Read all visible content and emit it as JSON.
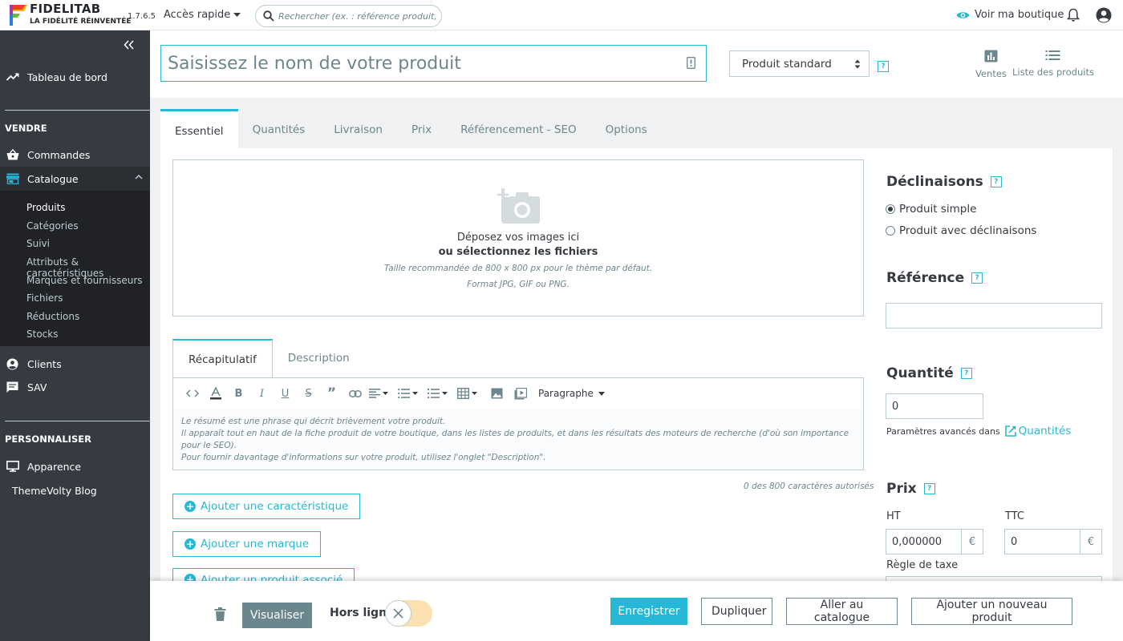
{
  "header": {
    "brand": "FIDELITAB",
    "tagline": "LA FIDÉLITÉ RÉINVENTÉE",
    "version": "1.7.6.5",
    "quick_access": "Accès rapide",
    "search_placeholder": "Rechercher (ex. : référence produit, nom",
    "view_shop": "Voir ma boutique",
    "accent": "#25b9d7"
  },
  "sidebar": {
    "dashboard": "Tableau de bord",
    "section_sell": "VENDRE",
    "orders": "Commandes",
    "catalog": "Catalogue",
    "catalog_sub": [
      "Produits",
      "Catégories",
      "Suivi",
      "Attributs & caractéristiques",
      "Marques et fournisseurs",
      "Fichiers",
      "Réductions",
      "Stocks"
    ],
    "clients": "Clients",
    "sav": "SAV",
    "section_customize": "PERSONNALISER",
    "appearance": "Apparence",
    "blog": "ThemeVolty Blog"
  },
  "product": {
    "name_placeholder": "Saisissez le nom de votre produit",
    "type_value": "Produit standard",
    "sales": "Ventes",
    "product_list": "Liste des produits",
    "help": "?"
  },
  "tabs": [
    "Essentiel",
    "Quantités",
    "Livraison",
    "Prix",
    "Référencement - SEO",
    "Options"
  ],
  "dropzone": {
    "line1": "Déposez vos images ici",
    "line2": "ou sélectionnez les fichiers",
    "line3": "Taille recommandée de 800 x 800 px pour le thème par défaut.",
    "line4": "Format JPG, GIF ou PNG."
  },
  "subtabs": [
    "Récapitulatif",
    "Description"
  ],
  "editor": {
    "paragraph": "Paragraphe",
    "placeholder_lines": [
      "Le résumé est une phrase qui décrit brièvement votre produit.",
      "Il apparaît tout en haut de la fiche produit de votre boutique, dans les listes de produits, et dans les résultats des moteurs de recherche (d'où son importance pour le SEO).",
      "Pour fournir davantage d'informations sur votre produit, utilisez l'onglet \"Description\"."
    ],
    "char_count": "0 des 800 caractères autorisés"
  },
  "actions": {
    "add_feature": "Ajouter une caractéristique",
    "add_brand": "Ajouter une marque",
    "add_related": "Ajouter un produit associé"
  },
  "right": {
    "declinaisons": "Déclinaisons",
    "simple": "Produit simple",
    "with_variants": "Produit avec déclinaisons",
    "reference": "Référence",
    "reference_value": "",
    "quantity": "Quantité",
    "quantity_value": "0",
    "advanced": "Paramètres avancés dans",
    "advanced_link": "Quantités",
    "price": "Prix",
    "ht": "HT",
    "ht_value": "0,000000",
    "ttc": "TTC",
    "ttc_value": "0",
    "currency": "€",
    "tax_rule": "Règle de taxe"
  },
  "footer": {
    "preview": "Visualiser",
    "offline": "Hors ligne",
    "save": "Enregistrer",
    "duplicate": "Dupliquer",
    "go_catalog": "Aller au catalogue",
    "add_new": "Ajouter un nouveau produit"
  }
}
